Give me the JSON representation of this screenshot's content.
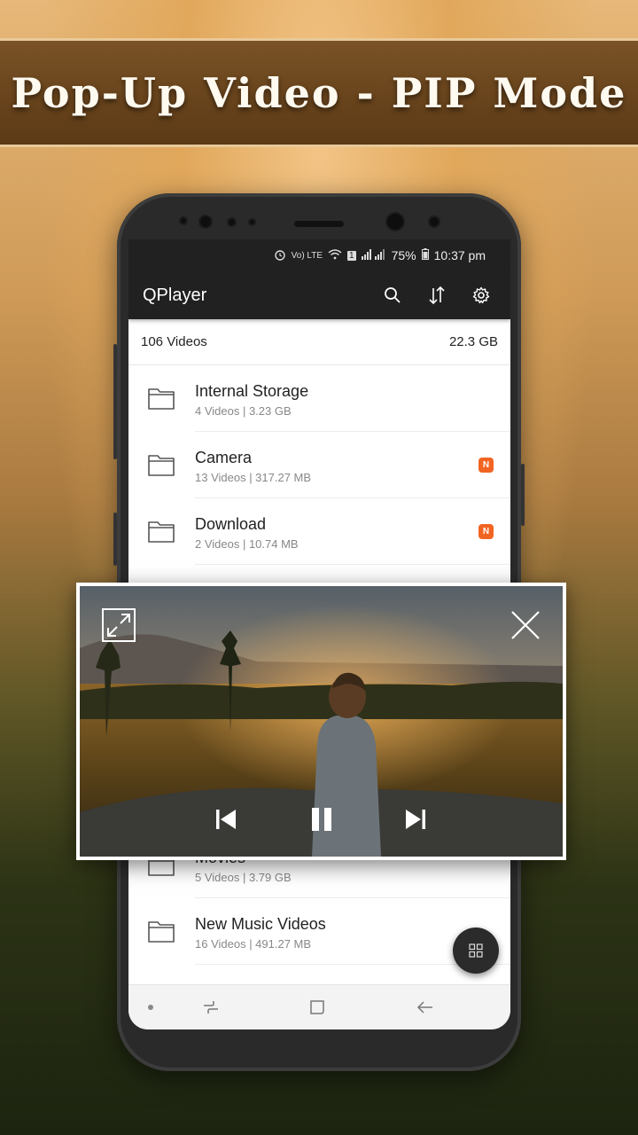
{
  "banner": {
    "title": "Pop-Up Video - PIP Mode"
  },
  "status_bar": {
    "battery": "75%",
    "time": "10:37 pm",
    "carrier_label": "Vo) LTE",
    "sim_indicator": "1"
  },
  "app_bar": {
    "title": "QPlayer",
    "actions": [
      "search-icon",
      "sort-icon",
      "settings-icon"
    ]
  },
  "summary": {
    "video_count": "106 Videos",
    "total_size": "22.3 GB"
  },
  "folders": [
    {
      "name": "Internal Storage",
      "meta": "4 Videos | 3.23 GB",
      "badge": ""
    },
    {
      "name": "Camera",
      "meta": "13 Videos | 317.27 MB",
      "badge": "N"
    },
    {
      "name": "Download",
      "meta": "2 Videos | 10.74 MB",
      "badge": "N"
    },
    {
      "name": "Movies",
      "meta": "5 Videos | 3.79 GB",
      "badge": ""
    },
    {
      "name": "New Music Videos",
      "meta": "16 Videos | 491.27 MB",
      "badge": ""
    }
  ],
  "pip": {
    "controls": [
      "expand-icon",
      "close-icon",
      "skip-previous-icon",
      "pause-icon",
      "skip-next-icon"
    ]
  },
  "nav_bar": {
    "icons": [
      "dot-icon",
      "recents-icon",
      "home-icon",
      "back-icon"
    ]
  },
  "colors": {
    "app_bar": "#212121",
    "badge": "#f26422",
    "banner": "#6a451d"
  }
}
